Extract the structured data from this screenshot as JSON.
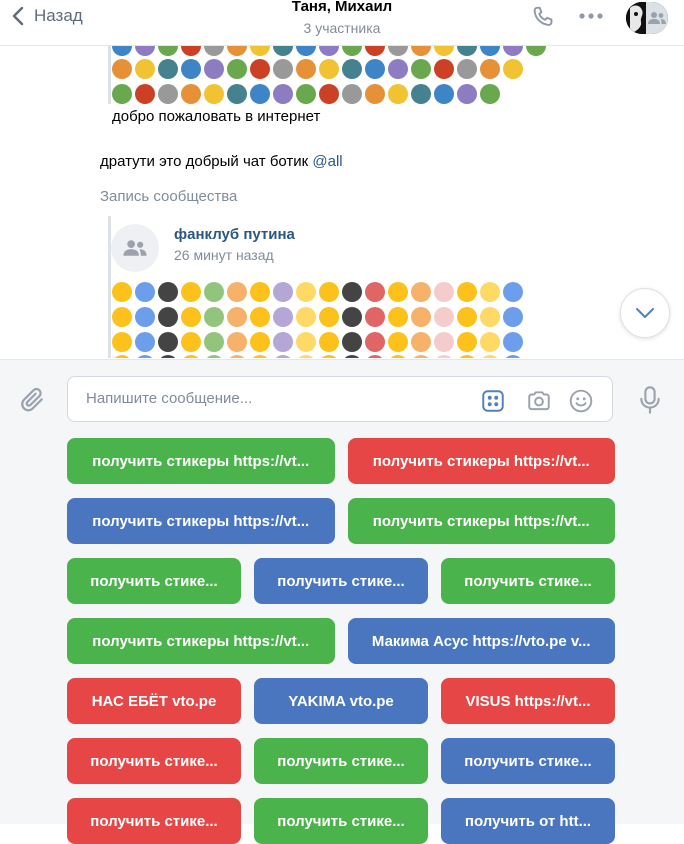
{
  "header": {
    "back_label": "Назад",
    "title": "Таня, Михаил",
    "subtitle": "3 участника"
  },
  "messages": {
    "welcome_text": "добро пожаловать в интернет",
    "chat_text_prefix": "дратути это добрый чат ботик ",
    "chat_mention": "@all",
    "repost_label": "Запись сообщества",
    "community_name": "фанклуб путина",
    "community_time": "26 минут назад"
  },
  "composer": {
    "placeholder": "Напишите сообщение...",
    "value": ""
  },
  "colors": {
    "green": "#4bb34b",
    "red": "#e64646",
    "blue": "#4a76c0",
    "link": "#2a5885",
    "muted": "#818c99"
  },
  "keyboard": [
    [
      {
        "label": "получить стикеры https://vt...",
        "color": "green"
      },
      {
        "label": "получить стикеры https://vt...",
        "color": "red"
      }
    ],
    [
      {
        "label": "получить стикеры https://vt...",
        "color": "blue"
      },
      {
        "label": "получить стикеры https://vt...",
        "color": "green"
      }
    ],
    [
      {
        "label": "получить стике...",
        "color": "green"
      },
      {
        "label": "получить стике...",
        "color": "blue"
      },
      {
        "label": "получить стике...",
        "color": "green"
      }
    ],
    [
      {
        "label": "получить стикеры https://vt...",
        "color": "green"
      },
      {
        "label": "Макима Асус https://vto.pe v...",
        "color": "blue"
      }
    ],
    [
      {
        "label": "НАС ЕБЁТ vto.pe",
        "color": "red"
      },
      {
        "label": "YAKIMA vto.pe",
        "color": "blue"
      },
      {
        "label": "VISUS https://vt...",
        "color": "red"
      }
    ],
    [
      {
        "label": "получить стике...",
        "color": "red"
      },
      {
        "label": "получить стике...",
        "color": "green"
      },
      {
        "label": "получить стике...",
        "color": "blue"
      }
    ],
    [
      {
        "label": "получить стике...",
        "color": "red"
      },
      {
        "label": "получить стике...",
        "color": "green"
      },
      {
        "label": "получить от htt...",
        "color": "blue"
      }
    ]
  ],
  "icons": {
    "back": "chevron-left-icon",
    "call": "phone-icon",
    "more": "more-horizontal-icon",
    "attach": "paperclip-icon",
    "bot_keyboard": "bot-keyboard-icon",
    "camera": "camera-icon",
    "emoji": "smile-icon",
    "voice": "microphone-icon",
    "scroll_down": "chevron-down-icon",
    "community_avatar": "users-icon"
  }
}
